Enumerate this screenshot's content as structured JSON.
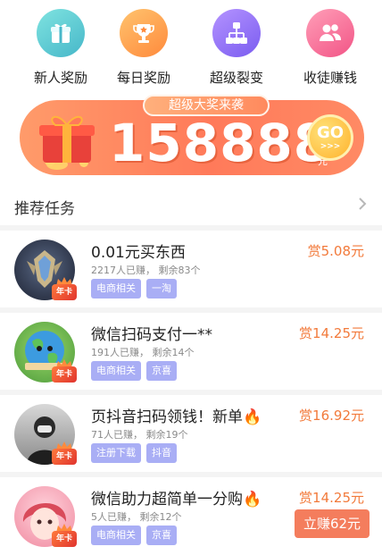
{
  "grid": [
    {
      "label": "新人奖励",
      "icon": "gift-icon",
      "color": "#46b7c9"
    },
    {
      "label": "每日奖励",
      "icon": "trophy-icon",
      "color": "#ff8a3c"
    },
    {
      "label": "超级裂变",
      "icon": "network-icon",
      "color": "#7a5cf0"
    },
    {
      "label": "收徒赚钱",
      "icon": "users-icon",
      "color": "#f25486"
    }
  ],
  "banner": {
    "tag": "超级大奖来袭",
    "number": "158888",
    "unit": "元",
    "go_label": "GO",
    "go_arrows": ">>>"
  },
  "section": {
    "title": "推荐任务"
  },
  "tasks": [
    {
      "title": "0.01元买东西",
      "meta": "2217人已赚， 剩余83个",
      "tags": [
        "电商相关",
        "一淘"
      ],
      "reward": "赏5.08元",
      "badge": "年卡",
      "avatar": "game-emblem-avatar"
    },
    {
      "title": "微信扫码支付一**",
      "meta": "191人已赚， 剩余14个",
      "tags": [
        "电商相关",
        "京喜"
      ],
      "reward": "赏14.25元",
      "badge": "年卡",
      "avatar": "earth-avatar"
    },
    {
      "title": "页抖音扫码领钱！新单🔥",
      "meta": "71人已赚， 剩余19个",
      "tags": [
        "注册下载",
        "抖音"
      ],
      "reward": "赏16.92元",
      "badge": "年卡",
      "avatar": "person-photo-avatar"
    },
    {
      "title": "微信助力超简单一分购🔥",
      "meta": "5人已赚， 剩余12个",
      "tags": [
        "电商相关",
        "京喜"
      ],
      "reward": "赏14.25元",
      "badge": "年卡",
      "avatar": "anime-avatar"
    }
  ],
  "earn_button": "立赚62元"
}
